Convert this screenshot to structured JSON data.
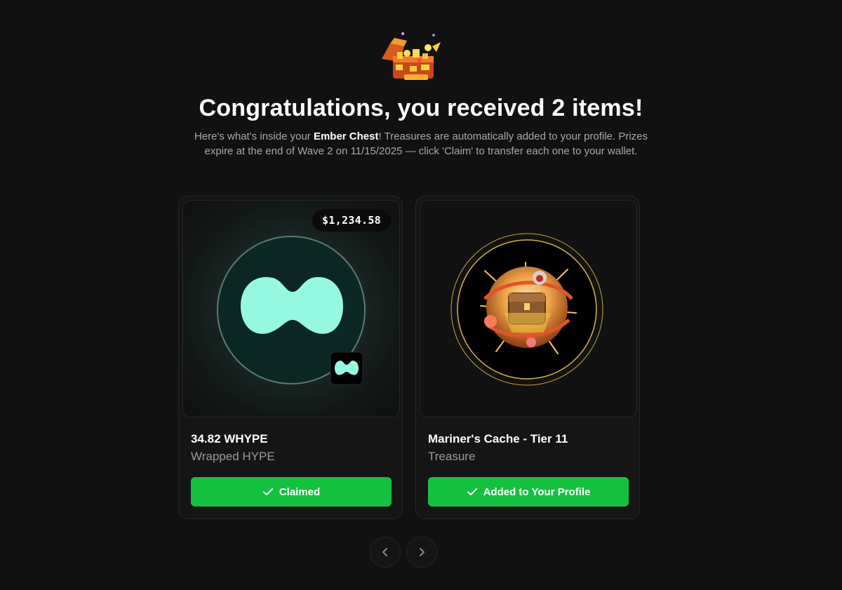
{
  "header": {
    "chest_icon": "treasure-chest-icon",
    "title": "Congratulations, you received 2 items!",
    "subtitle_pre": "Here's what's inside your ",
    "subtitle_chest": "Ember Chest",
    "subtitle_post": "! Treasures are automatically added to your profile. Prizes expire at the end of Wave 2 on 11/15/2025 — click 'Claim' to transfer each one to your wallet."
  },
  "items": [
    {
      "price": "$1,234.58",
      "name": "34.82 WHYPE",
      "subtitle": "Wrapped HYPE",
      "button_label": "Claimed",
      "icon": "hype-token-icon"
    },
    {
      "name": "Mariner's Cache - Tier 11",
      "subtitle": "Treasure",
      "button_label": "Added to Your Profile",
      "icon": "treasure-orb-icon"
    }
  ],
  "nav": {
    "prev_icon": "chevron-left-icon",
    "next_icon": "chevron-right-icon"
  },
  "colors": {
    "background": "#111111",
    "accent_green": "#14c13e",
    "hype_mint": "#97f8e2",
    "hype_dark": "#0b2723"
  }
}
